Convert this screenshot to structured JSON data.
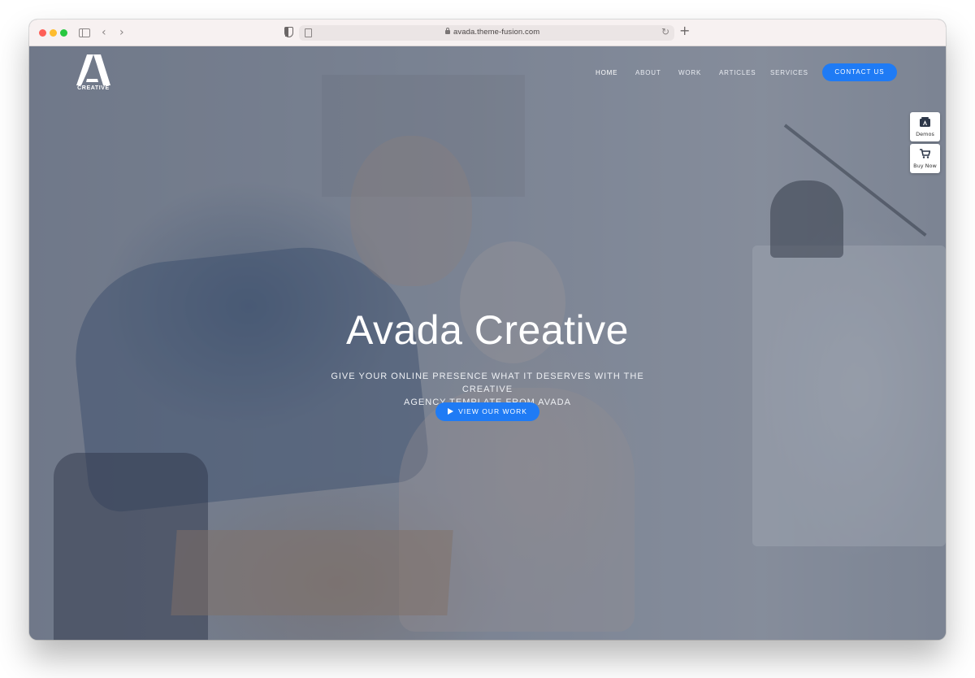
{
  "browser": {
    "url": "avada.theme-fusion.com"
  },
  "header": {
    "logo_word": "CREATIVE",
    "nav": [
      {
        "label": "HOME"
      },
      {
        "label": "ABOUT"
      },
      {
        "label": "WORK"
      },
      {
        "label": "ARTICLES"
      },
      {
        "label": "SERVICES"
      }
    ],
    "contact_label": "CONTACT US"
  },
  "side_widgets": {
    "demos_label": "Demos",
    "buy_label": "Buy Now"
  },
  "hero": {
    "title": "Avada Creative",
    "subtitle_line1": "GIVE YOUR ONLINE PRESENCE WHAT IT DESERVES WITH THE CREATIVE",
    "subtitle_line2": "AGENCY TEMPLATE FROM AVADA",
    "cta_label": "VIEW OUR WORK"
  },
  "colors": {
    "accent": "#1f7bf5",
    "overlay": "#485064"
  }
}
